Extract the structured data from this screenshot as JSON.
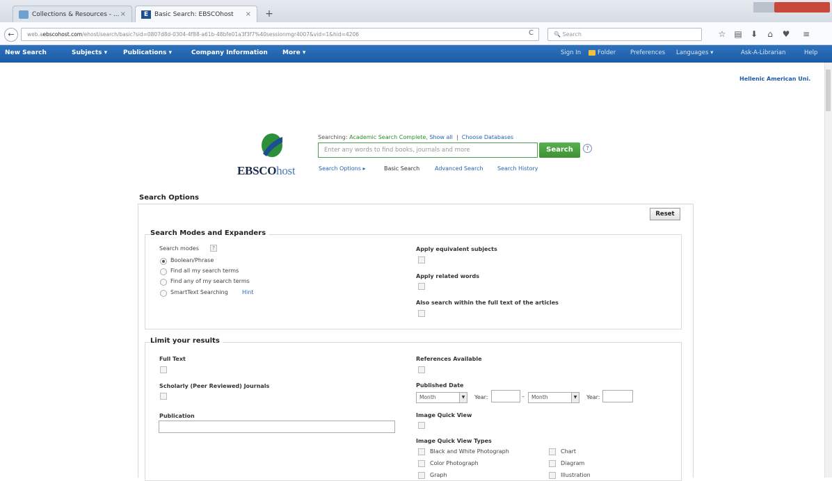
{
  "browser": {
    "tabs": [
      {
        "label": "Collections & Resources - ...",
        "close": "×"
      },
      {
        "label": "Basic Search: EBSCOhost",
        "close": "×"
      }
    ],
    "new_tab": "+",
    "url": {
      "prefix": "web.a",
      "domain": "ebscohost.com",
      "rest": "/ehost/search/basic?sid=0807d8d-0304-4f88-a61b-48bfe01a3f3f7%40sessionmgr4007&vid=1&hid=4206"
    },
    "search_placeholder": "Search",
    "back_glyph": "←",
    "reload_glyph": "C",
    "toolbar_icons": [
      "star-icon",
      "clipboard-icon",
      "download-icon",
      "home-icon",
      "pocket-icon",
      "menu-icon"
    ]
  },
  "ebsco_nav": {
    "left": [
      "New Search",
      "Subjects ▾",
      "Publications ▾",
      "Company Information",
      "More ▾"
    ],
    "right": {
      "sign_in": "Sign In",
      "folder": "Folder",
      "preferences": "Preferences",
      "languages": "Languages ▾",
      "ask": "Ask-A-Librarian",
      "help": "Help"
    },
    "institution": "Hellenic American Uni."
  },
  "search": {
    "logo_text": "EBSCO",
    "logo_suffix": "host",
    "searching_prefix": "Searching:",
    "database": "Academic Search Complete,",
    "show_all": "Show all",
    "choose_db": "Choose Databases",
    "placeholder": "Enter any words to find books, journals and more",
    "button": "Search",
    "help": "?",
    "links": [
      "Search Options ▸",
      "Basic Search",
      "Advanced Search",
      "Search History"
    ]
  },
  "options": {
    "heading": "Search Options",
    "reset": "Reset",
    "modes": {
      "legend": "Search Modes and Expanders",
      "label": "Search modes",
      "help": "?",
      "radios": [
        "Boolean/Phrase",
        "Find all my search terms",
        "Find any of my search terms",
        "SmartText Searching"
      ],
      "hint": "Hint",
      "right": [
        "Apply equivalent subjects",
        "Apply related words",
        "Also search within the full text of the articles"
      ]
    },
    "limits": {
      "legend": "Limit your results",
      "full_text": "Full Text",
      "scholarly": "Scholarly (Peer Reviewed) Journals",
      "publication": "Publication",
      "references": "References Available",
      "published_date": "Published Date",
      "month": "Month",
      "year": "Year:",
      "dash": "–",
      "iqv": "Image Quick View",
      "iqv_types": "Image Quick View Types",
      "types_left": [
        "Black and White Photograph",
        "Color Photograph",
        "Graph"
      ],
      "types_right": [
        "Chart",
        "Diagram",
        "Illustration"
      ]
    }
  }
}
